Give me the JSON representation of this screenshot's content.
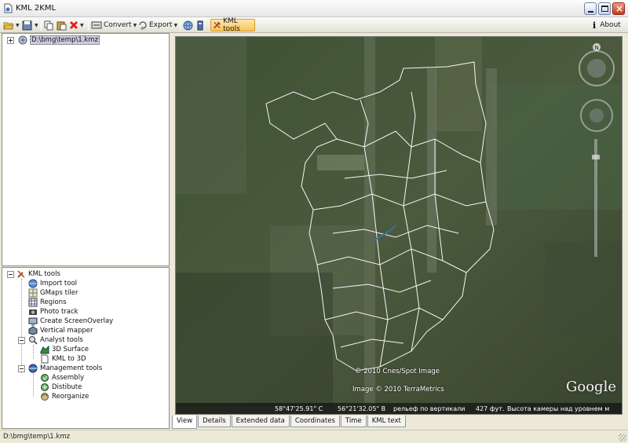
{
  "window": {
    "title": "KML 2KML"
  },
  "toolbar": {
    "convert_label": "Convert",
    "export_label": "Export",
    "kml_tools_label": "KML tools",
    "about_label": "About"
  },
  "tree_top": {
    "root_file": "D:\\bmg\\temp\\1.kmz"
  },
  "tree_bottom": {
    "root": "KML tools",
    "items": [
      "Import tool",
      "GMaps tiler",
      "Regions",
      "Photo track",
      "Create ScreenOverlay",
      "Vertical mapper"
    ],
    "analyst": {
      "label": "Analyst tools",
      "children": [
        "3D Surface",
        "KML to 3D"
      ]
    },
    "management": {
      "label": "Management tools",
      "children": [
        "Assembly",
        "Distibute",
        "Reorganize"
      ]
    }
  },
  "map": {
    "credit_spot": "© 2010 Cnes/Spot Image",
    "credit_terra": "Image © 2010 TerraMetrics",
    "logo": "Google",
    "status": {
      "lat": "58°47'25.91\" C",
      "lon": "56°21'32.05\" В",
      "relief": "рельеф по вертикали",
      "elevation": "427 фут.",
      "camera": "Высота камеры над уровнем  м"
    }
  },
  "tabs": [
    "View",
    "Details",
    "Extended data",
    "Coordinates",
    "Time",
    "KML text"
  ],
  "active_tab": "View",
  "statusbar": {
    "path": "D:\\bmg\\temp\\1.kmz"
  }
}
